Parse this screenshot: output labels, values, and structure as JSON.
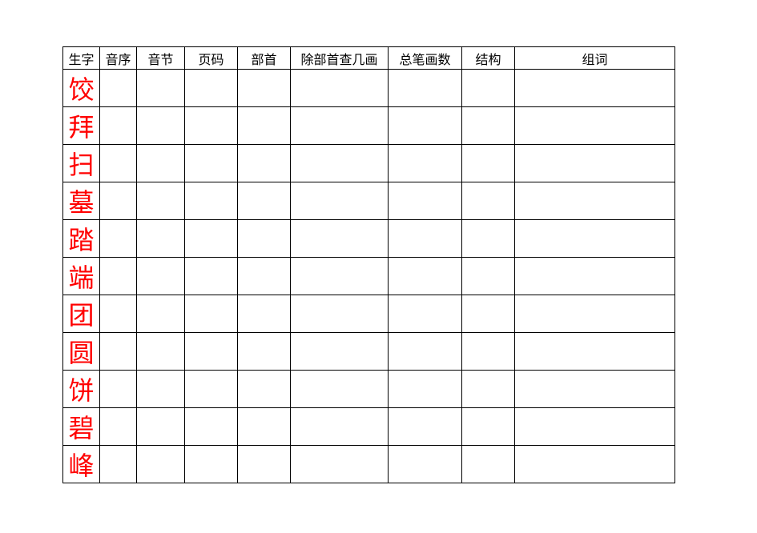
{
  "chart_data": {
    "type": "table",
    "headers": [
      "生字",
      "音序",
      "音节",
      "页码",
      "部首",
      "除部首查几画",
      "总笔画数",
      "结构",
      "组词"
    ],
    "rows": [
      {
        "char": "饺",
        "cells": [
          "",
          "",
          "",
          "",
          "",
          "",
          "",
          ""
        ]
      },
      {
        "char": "拜",
        "cells": [
          "",
          "",
          "",
          "",
          "",
          "",
          "",
          ""
        ]
      },
      {
        "char": "扫",
        "cells": [
          "",
          "",
          "",
          "",
          "",
          "",
          "",
          ""
        ]
      },
      {
        "char": "墓",
        "cells": [
          "",
          "",
          "",
          "",
          "",
          "",
          "",
          ""
        ]
      },
      {
        "char": "踏",
        "cells": [
          "",
          "",
          "",
          "",
          "",
          "",
          "",
          ""
        ]
      },
      {
        "char": "端",
        "cells": [
          "",
          "",
          "",
          "",
          "",
          "",
          "",
          ""
        ]
      },
      {
        "char": "团",
        "cells": [
          "",
          "",
          "",
          "",
          "",
          "",
          "",
          ""
        ]
      },
      {
        "char": "圆",
        "cells": [
          "",
          "",
          "",
          "",
          "",
          "",
          "",
          ""
        ]
      },
      {
        "char": "饼",
        "cells": [
          "",
          "",
          "",
          "",
          "",
          "",
          "",
          ""
        ]
      },
      {
        "char": "碧",
        "cells": [
          "",
          "",
          "",
          "",
          "",
          "",
          "",
          ""
        ]
      },
      {
        "char": "峰",
        "cells": [
          "",
          "",
          "",
          "",
          "",
          "",
          "",
          ""
        ]
      }
    ]
  }
}
